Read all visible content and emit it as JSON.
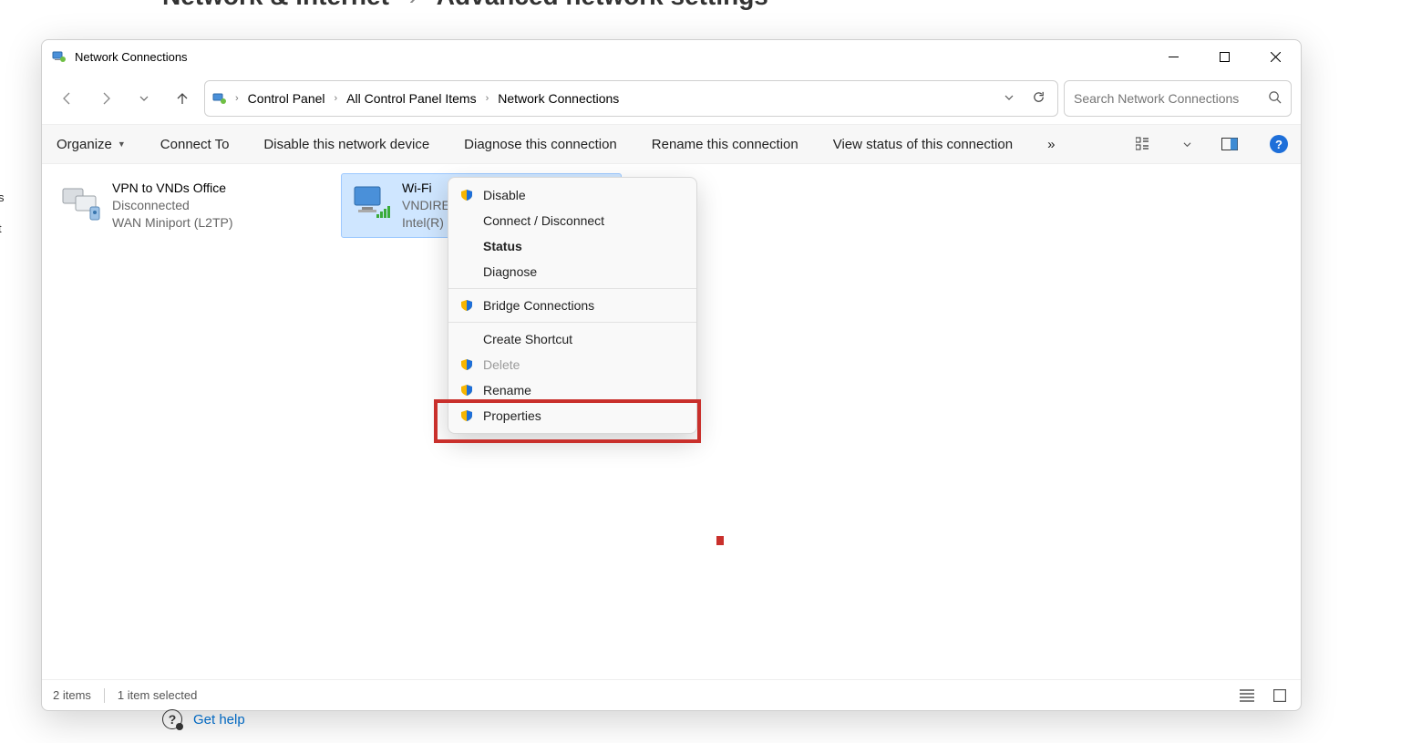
{
  "background": {
    "crumb_left": "Network & internet",
    "crumb_right": "Advanced network settings",
    "help_text": "Get help"
  },
  "window": {
    "title": "Network Connections"
  },
  "sidebar_peek": [
    "s",
    "t"
  ],
  "breadcrumb": {
    "segments": [
      "Control Panel",
      "All Control Panel Items",
      "Network Connections"
    ]
  },
  "search": {
    "placeholder": "Search Network Connections"
  },
  "toolbar": {
    "organize": "Organize",
    "connect_to": "Connect To",
    "disable": "Disable this network device",
    "diagnose": "Diagnose this connection",
    "rename": "Rename this connection",
    "view_status": "View status of this connection",
    "overflow": "»"
  },
  "adapters": [
    {
      "name": "VPN to VNDs Office",
      "status": "Disconnected",
      "device": "WAN Miniport (L2TP)",
      "selected": false,
      "icon": "vpn"
    },
    {
      "name": "Wi-Fi",
      "status": "VNDIRE",
      "device": "Intel(R)",
      "selected": true,
      "icon": "wifi"
    }
  ],
  "context_menu": {
    "items": [
      {
        "label": "Disable",
        "shield": true
      },
      {
        "label": "Connect / Disconnect",
        "shield": false
      },
      {
        "label": "Status",
        "shield": false,
        "bold": true
      },
      {
        "label": "Diagnose",
        "shield": false
      },
      {
        "sep": true
      },
      {
        "label": "Bridge Connections",
        "shield": true
      },
      {
        "sep": true
      },
      {
        "label": "Create Shortcut",
        "shield": false
      },
      {
        "label": "Delete",
        "shield": true,
        "disabled": true
      },
      {
        "label": "Rename",
        "shield": true
      },
      {
        "label": "Properties",
        "shield": true,
        "highlight": true
      }
    ]
  },
  "statusbar": {
    "count": "2 items",
    "selected": "1 item selected"
  }
}
